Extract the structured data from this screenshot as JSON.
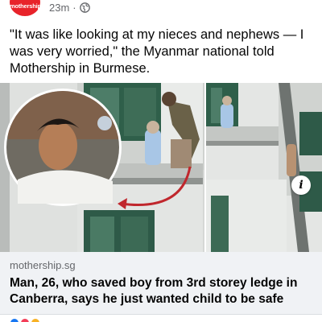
{
  "post": {
    "page_avatar_text": "mothership",
    "timestamp": "23m",
    "separator": "·",
    "audience_icon": "globe-icon",
    "caption": "\"It was like looking at my nieces and nephews — I was very worried,\" the Myanmar national told Mothership in Burmese."
  },
  "image": {
    "info_icon": "info-icon",
    "info_glyph": "i"
  },
  "link_preview": {
    "domain": "mothership.sg",
    "title": "Man, 26, who saved boy from 3rd storey ledge in Canberra, says he just wanted child to be safe"
  },
  "reactions": [
    {
      "name": "like-reaction-icon",
      "color": "#1877f2"
    },
    {
      "name": "love-reaction-icon",
      "color": "#f33e58"
    },
    {
      "name": "care-reaction-icon",
      "color": "#f7b125"
    }
  ],
  "colors": {
    "brand_red": "#e8232a",
    "meta_gray": "#65676b",
    "preview_bg": "#f0f2f5"
  }
}
